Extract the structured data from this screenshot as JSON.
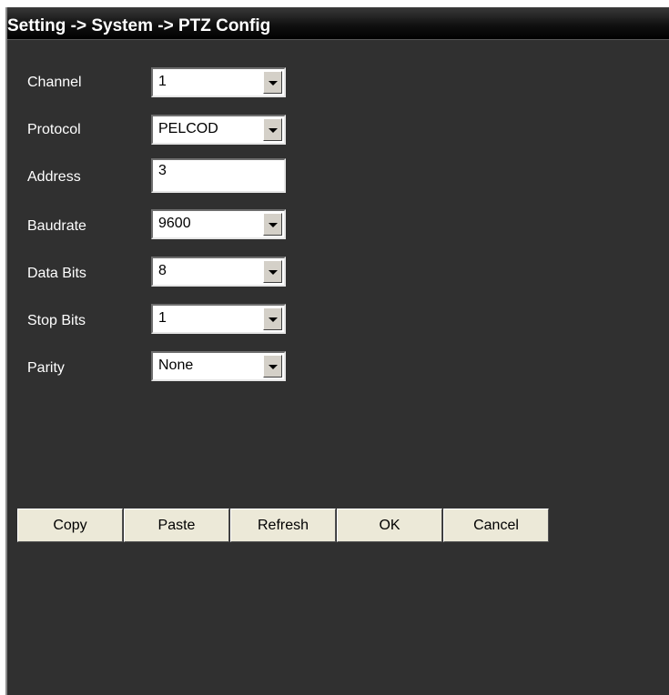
{
  "window": {
    "title": "Setting -> System -> PTZ Config"
  },
  "form": {
    "channel": {
      "label": "Channel",
      "value": "1"
    },
    "protocol": {
      "label": "Protocol",
      "value": "PELCOD"
    },
    "address": {
      "label": "Address",
      "value": "3"
    },
    "baudrate": {
      "label": "Baudrate",
      "value": "9600"
    },
    "data_bits": {
      "label": "Data Bits",
      "value": "8"
    },
    "stop_bits": {
      "label": "Stop Bits",
      "value": "1"
    },
    "parity": {
      "label": "Parity",
      "value": "None"
    }
  },
  "buttons": {
    "copy": "Copy",
    "paste": "Paste",
    "refresh": "Refresh",
    "ok": "OK",
    "cancel": "Cancel"
  },
  "icons": {
    "dropdown": "chevron-down-icon"
  },
  "colors": {
    "panel_background": "#303030",
    "titlebar": "#000000",
    "button_face": "#ece9d8"
  }
}
